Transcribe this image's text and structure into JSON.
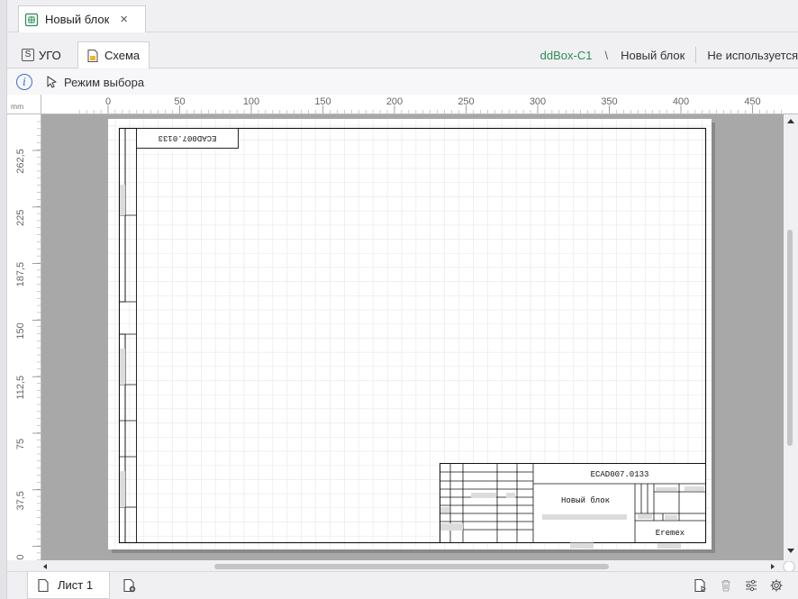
{
  "window": {
    "tab_title": "Новый блок",
    "tab_close": "×"
  },
  "subtabs": {
    "ugo_letter": "S",
    "ugo_label": "УГО",
    "schema_label": "Схема"
  },
  "breadcrumb": {
    "project": "ddBox-C1",
    "separator": "\\",
    "block": "Новый блок",
    "status": "Не используется"
  },
  "toolbar": {
    "info_glyph": "i",
    "mode_label": "Режим выбора"
  },
  "ruler": {
    "unit": "mm",
    "h_labels": [
      "0",
      "50",
      "100",
      "150",
      "200",
      "250",
      "300",
      "350",
      "400",
      "450"
    ],
    "v_labels": [
      "262,5",
      "225",
      "187,5",
      "150",
      "112,5",
      "75",
      "37,5",
      "0"
    ]
  },
  "drawing": {
    "rotated_code": "ECAD007.0133",
    "doc_code": "ECAD007.0133",
    "block_name": "Новый блок",
    "company": "Eremex"
  },
  "footer": {
    "sheet_label": "Лист 1"
  },
  "colors": {
    "accent_green": "#2e8b57",
    "accent_blue": "#3a6fd8",
    "canvas_gray": "#a8a8a8"
  }
}
